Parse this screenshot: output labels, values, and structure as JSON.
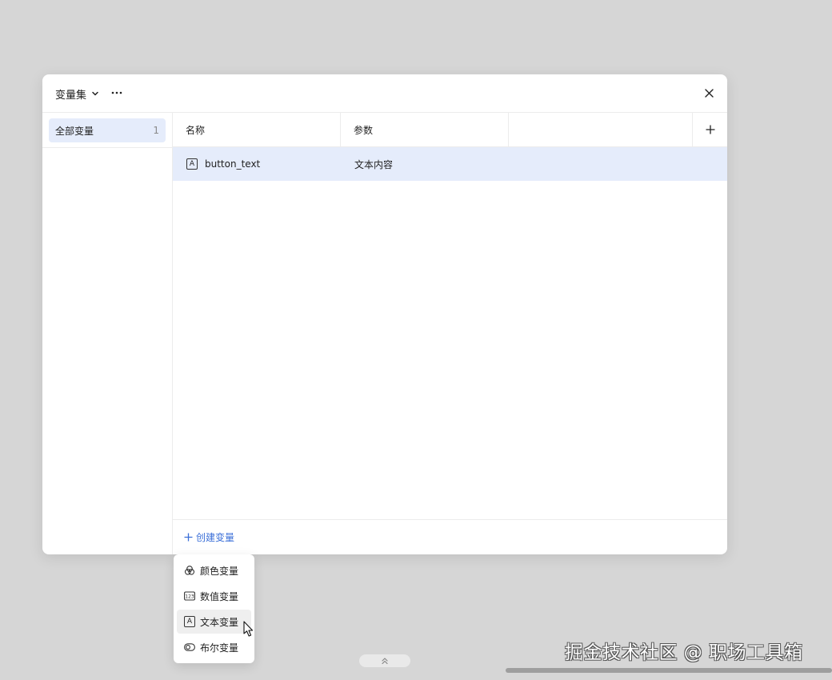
{
  "header": {
    "title": "变量集",
    "more_label": "···",
    "close_label": "×"
  },
  "sidebar": {
    "items": [
      {
        "label": "全部变量",
        "count": "1"
      }
    ]
  },
  "table": {
    "columns": [
      "名称",
      "参数",
      ""
    ],
    "add_column_label": "+",
    "rows": [
      {
        "icon": "text-variable-icon",
        "name": "button_text",
        "param": "文本内容"
      }
    ]
  },
  "footer": {
    "create_label": "创建变量"
  },
  "dropdown": {
    "items": [
      {
        "icon": "color-variable-icon",
        "label": "颜色变量"
      },
      {
        "icon": "number-variable-icon",
        "label": "数值变量"
      },
      {
        "icon": "text-variable-icon",
        "label": "文本变量",
        "hovered": true
      },
      {
        "icon": "boolean-variable-icon",
        "label": "布尔变量"
      }
    ]
  },
  "watermark": "掘金技术社区 @ 职场工具箱",
  "colors": {
    "accent": "#3b6fd8",
    "selected_bg": "#e5ecfb",
    "backdrop": "#d6d6d6"
  }
}
